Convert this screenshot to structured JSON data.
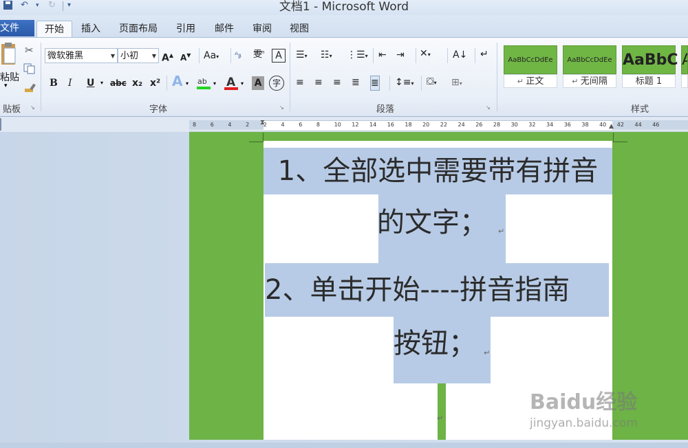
{
  "window": {
    "title": "文档1 - Microsoft Word"
  },
  "tabs": {
    "file": "文件",
    "items": [
      "开始",
      "插入",
      "页面布局",
      "引用",
      "邮件",
      "审阅",
      "视图"
    ]
  },
  "clipboard": {
    "paste_label": "粘贴",
    "group_label": "贴板"
  },
  "font": {
    "name": "微软雅黑",
    "size": "小初",
    "group_label": "字体",
    "bold": "B",
    "italic": "I",
    "underline": "U",
    "strike": "abc",
    "subscript": "x₂",
    "superscript": "x²",
    "font_color_letter": "A"
  },
  "paragraph": {
    "group_label": "段落"
  },
  "styles": {
    "group_label": "样式",
    "items": [
      {
        "sample": "AaBbCcDdEe",
        "label": "正文"
      },
      {
        "sample": "AaBbCcDdEe",
        "label": "无间隔"
      },
      {
        "sample": "AaBbC",
        "label": "标题 1"
      },
      {
        "sample": "A",
        "label": ""
      }
    ]
  },
  "ruler": {
    "ticks": [
      "8",
      "6",
      "4",
      "2",
      "2",
      "4",
      "6",
      "8",
      "10",
      "12",
      "14",
      "16",
      "18",
      "20",
      "22",
      "24",
      "26",
      "28",
      "30",
      "32",
      "34",
      "36",
      "38",
      "40",
      "42",
      "44",
      "46"
    ]
  },
  "document": {
    "line1": "1、全部选中需要带有拼音",
    "line2": "的文字；",
    "line3": "2、单击开始----拼音指南",
    "line4": "按钮；",
    "para_mark": "↵"
  },
  "watermark": {
    "logo": "Baidu经验",
    "url": "jingyan.baidu.com"
  },
  "colors": {
    "page_bg": "#6db346",
    "selection": "#b7cbe6",
    "file_tab": "#2e5fae"
  }
}
